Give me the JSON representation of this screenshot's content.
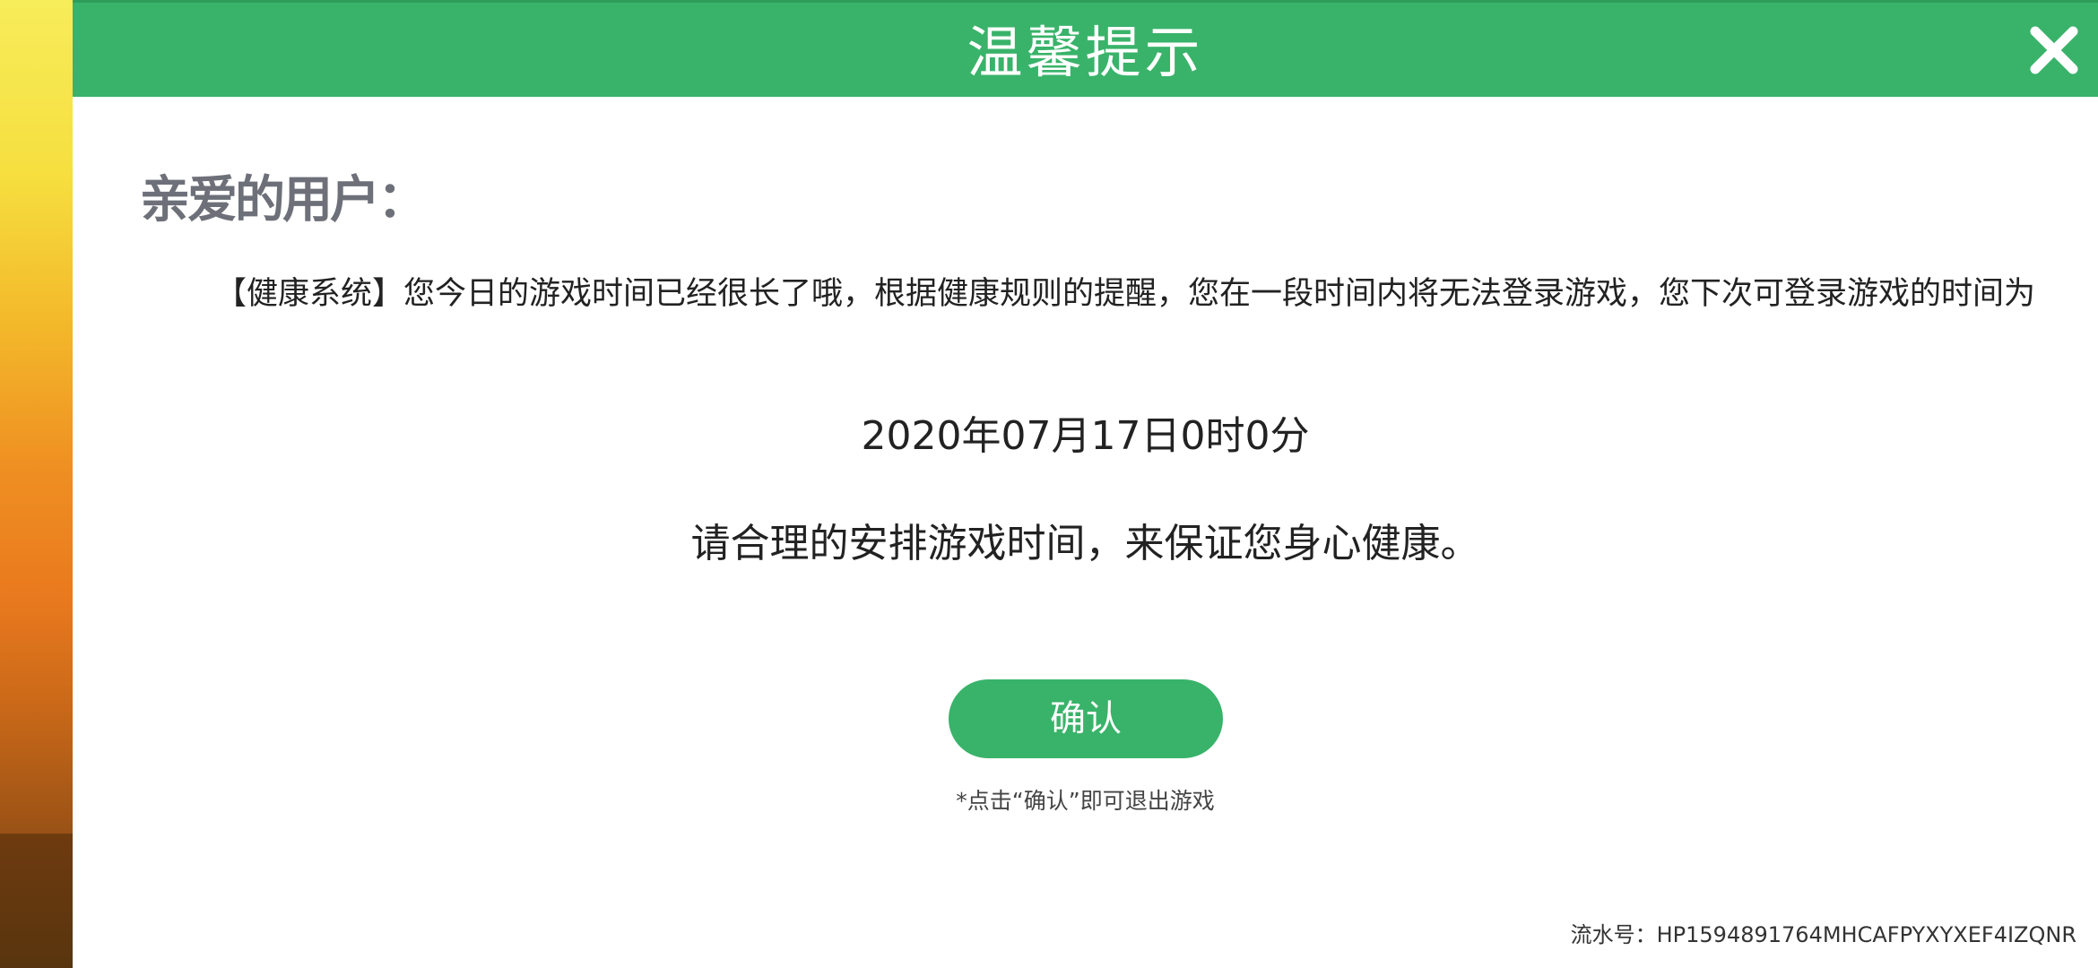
{
  "dialog": {
    "title": "温馨提示",
    "close_icon": "close-icon",
    "greeting": "亲爱的用户：",
    "message": "【健康系统】您今日的游戏时间已经很长了哦，根据健康规则的提醒，您在一段时间内将无法登录游戏，您下次可登录游戏的时间为",
    "next_login_time": "2020年07月17日0时0分",
    "advice": "请合理的安排游戏时间，来保证您身心健康。",
    "confirm_label": "确认",
    "hint": "*点击“确认”即可退出游戏",
    "serial_label": "流水号：",
    "serial_value": "HP1594891764MHCAFPYXYXEF4IZQNR"
  },
  "colors": {
    "accent": "#39b36a",
    "greeting_text": "#6e7079",
    "body_text": "#222222"
  }
}
